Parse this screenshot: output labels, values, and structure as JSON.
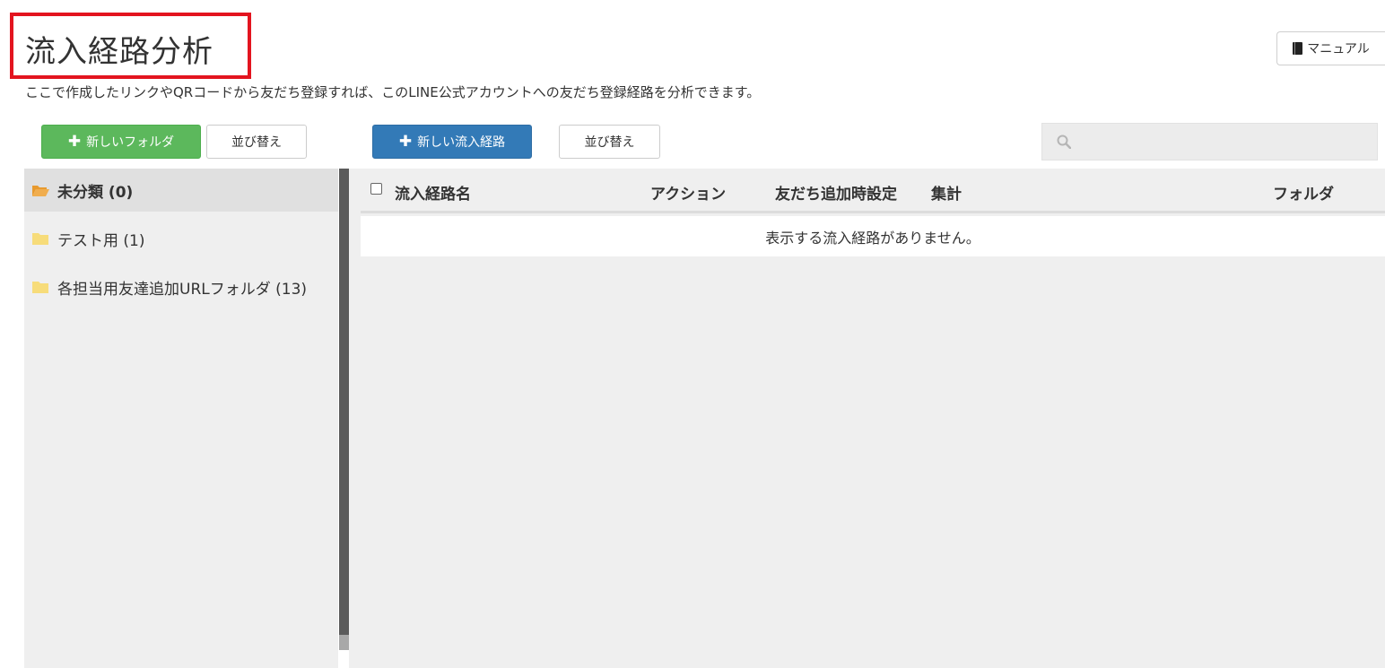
{
  "header": {
    "title": "流入経路分析",
    "description": "ここで作成したリンクやQRコードから友だち登録すれば、このLINE公式アカウントへの友だち登録経路を分析できます。",
    "manual_label": "マニュアル"
  },
  "toolbar": {
    "new_folder_label": "新しいフォルダ",
    "folder_sort_label": "並び替え",
    "new_route_label": "新しい流入経路",
    "route_sort_label": "並び替え",
    "search_placeholder": ""
  },
  "sidebar": {
    "folders": [
      {
        "label": "未分類 (0)",
        "icon": "folder-open-icon",
        "active": true
      },
      {
        "label": "テスト用 (1)",
        "icon": "folder-icon",
        "active": false
      },
      {
        "label": "各担当用友達追加URLフォルダ (13)",
        "icon": "folder-icon",
        "active": false
      }
    ]
  },
  "table": {
    "columns": [
      "流入経路名",
      "アクション",
      "友だち追加時設定",
      "集計",
      "フォルダ"
    ],
    "empty_message": "表示する流入経路がありません。"
  },
  "colors": {
    "highlight_border": "#e3141f",
    "green_button": "#5cb85c",
    "blue_button": "#337ab7",
    "folder_open": "#f0ad4e",
    "folder_closed": "#f7dc7a"
  }
}
